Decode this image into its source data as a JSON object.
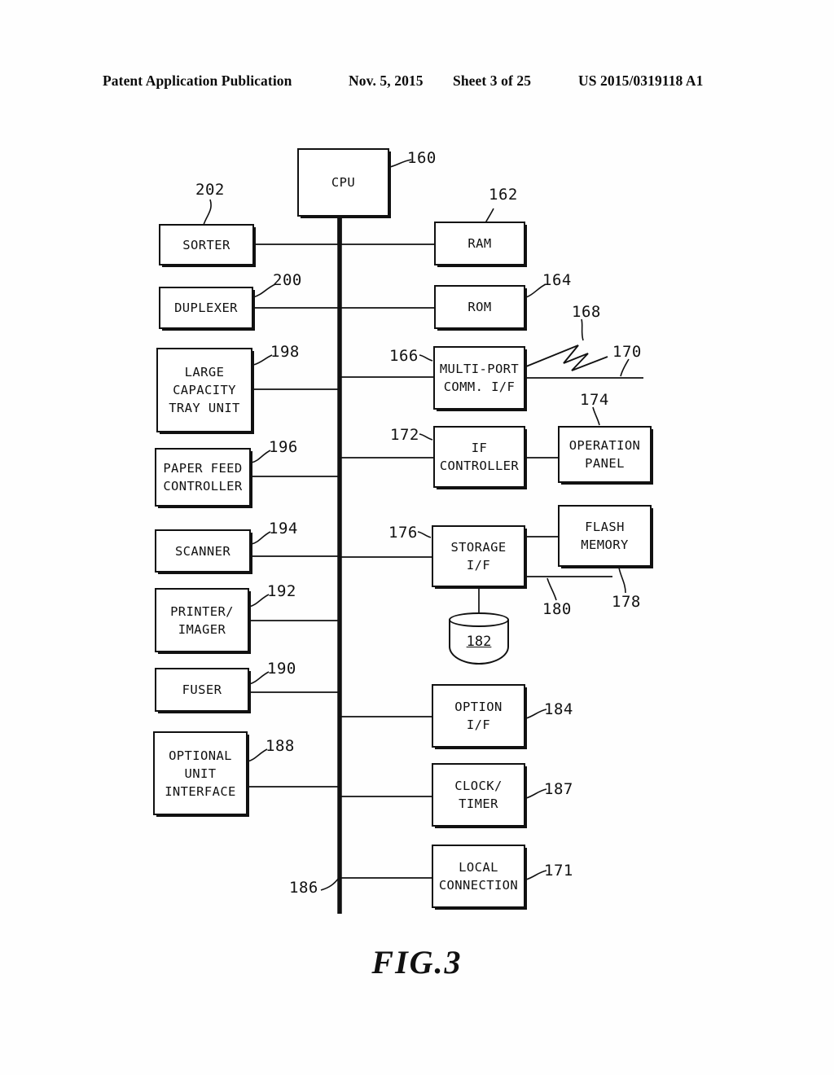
{
  "header": {
    "publication": "Patent Application Publication",
    "date": "Nov. 5, 2015",
    "sheet": "Sheet 3 of 25",
    "patent_number": "US 2015/0319118 A1"
  },
  "figure": {
    "caption": "FIG.3",
    "bus_ref": "186",
    "disk_label": "182"
  },
  "blocks": {
    "cpu": {
      "label": "CPU",
      "ref": "160"
    },
    "sorter": {
      "label": "SORTER",
      "ref": "202"
    },
    "duplexer": {
      "label": "DUPLEXER",
      "ref": "200"
    },
    "large_tray": {
      "label": "LARGE\nCAPACITY\nTRAY UNIT",
      "ref": "198"
    },
    "paper_feed": {
      "label": "PAPER FEED\nCONTROLLER",
      "ref": "196"
    },
    "scanner": {
      "label": "SCANNER",
      "ref": "194"
    },
    "printer": {
      "label": "PRINTER/\nIMAGER",
      "ref": "192"
    },
    "fuser": {
      "label": "FUSER",
      "ref": "190"
    },
    "optional_unit": {
      "label": "OPTIONAL\nUNIT\nINTERFACE",
      "ref": "188"
    },
    "ram": {
      "label": "RAM",
      "ref": "162"
    },
    "rom": {
      "label": "ROM",
      "ref": "164"
    },
    "multiport": {
      "label": "MULTI-PORT\nCOMM. I/F",
      "ref": "166"
    },
    "if_controller": {
      "label": "IF\nCONTROLLER",
      "ref": "172"
    },
    "operation_panel": {
      "label": "OPERATION\nPANEL",
      "ref": "174"
    },
    "storage_if": {
      "label": "STORAGE\nI/F",
      "ref": "176"
    },
    "flash_memory": {
      "label": "FLASH\nMEMORY",
      "ref": "178"
    },
    "option_if": {
      "label": "OPTION\nI/F",
      "ref": "184"
    },
    "clock_timer": {
      "label": "CLOCK/\nTIMER",
      "ref": "187"
    },
    "local_conn": {
      "label": "LOCAL\nCONNECTION",
      "ref": "171"
    }
  },
  "link_refs": {
    "wireless": "168",
    "network_line": "170",
    "storage_bus": "180"
  }
}
